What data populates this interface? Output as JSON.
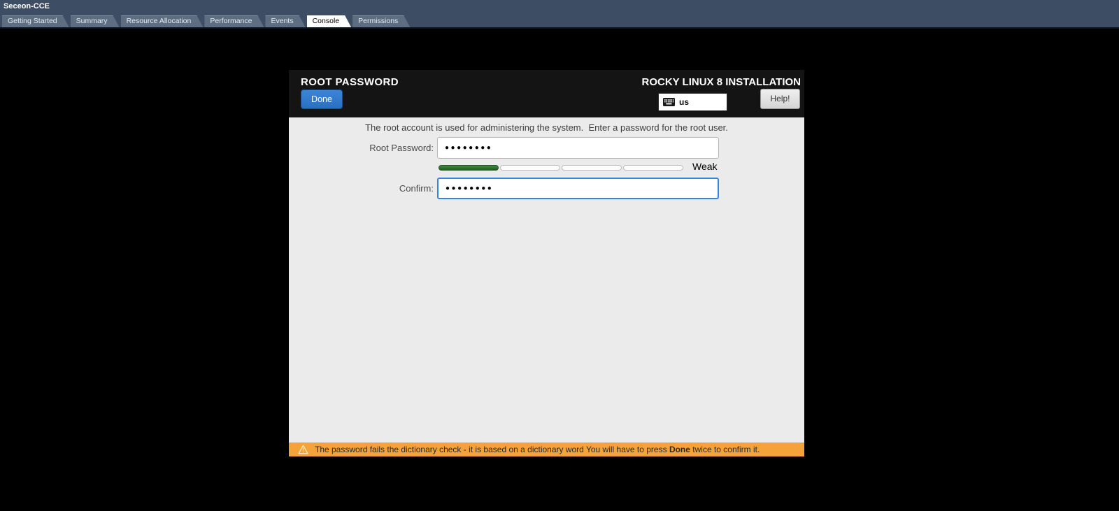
{
  "vm_header": {
    "title": "Seceon-CCE",
    "tabs": [
      {
        "label": "Getting Started"
      },
      {
        "label": "Summary"
      },
      {
        "label": "Resource Allocation"
      },
      {
        "label": "Performance"
      },
      {
        "label": "Events"
      },
      {
        "label": "Console"
      },
      {
        "label": "Permissions"
      }
    ],
    "active_tab": "Console"
  },
  "installer": {
    "header": {
      "title": "ROOT PASSWORD",
      "brand": "ROCKY LINUX 8 INSTALLATION",
      "done_label": "Done",
      "keyboard_layout": "us",
      "help_label": "Help!"
    },
    "form": {
      "info_text": "The root account is used for administering the system.  Enter a password for the root user.",
      "root_password_label": "Root Password:",
      "root_password_value": "●●●●●●●●",
      "confirm_label": "Confirm:",
      "confirm_value": "●●●●●●●●",
      "strength_label": "Weak",
      "strength_filled_segments": 1,
      "strength_total_segments": 4
    },
    "warning": {
      "text_before": "The password fails the dictionary check - it is based on a dictionary word You will have to press ",
      "bold_word": "Done",
      "text_after": " twice to confirm it."
    },
    "colors": {
      "header_bg": "#141414",
      "content_bg": "#ebebeb",
      "warning_bg": "#f3a339",
      "done_button_bg": "#2d77c8",
      "focus_border": "#3584e4",
      "strength_fill_green": "#2c722c",
      "topbar_bg": "#3d4e64"
    }
  }
}
